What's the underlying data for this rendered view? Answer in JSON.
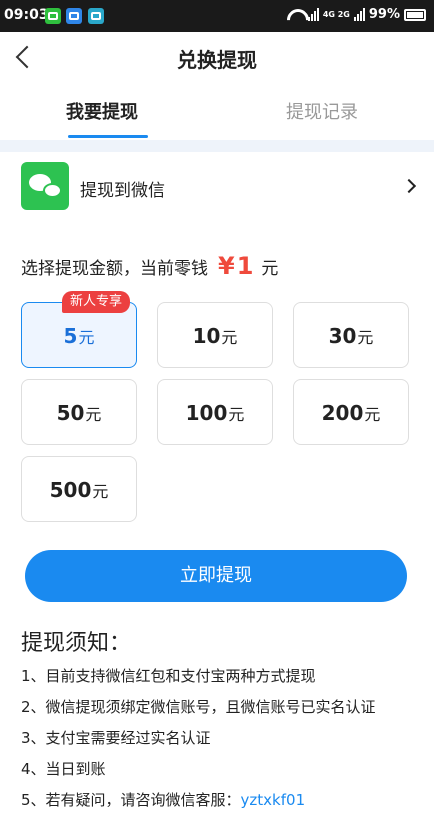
{
  "status_bar": {
    "time": "09:03",
    "battery": "99%",
    "network": "4G 2G",
    "app_icons": [
      "wechat-icon",
      "message-icon",
      "scan-icon"
    ]
  },
  "nav": {
    "title": "兑换提现"
  },
  "tabs": [
    {
      "label": "我要提现",
      "active": true
    },
    {
      "label": "提现记录",
      "active": false
    }
  ],
  "wechat_option": {
    "label": "提现到微信"
  },
  "amount_heading": {
    "prefix": "选择提现金额，当前零钱",
    "currency_symbol": "¥",
    "balance": "1",
    "unit": "元"
  },
  "amounts": [
    {
      "value": "5",
      "unit": "元",
      "selected": true,
      "badge": "新人专享"
    },
    {
      "value": "10",
      "unit": "元"
    },
    {
      "value": "30",
      "unit": "元"
    },
    {
      "value": "50",
      "unit": "元"
    },
    {
      "value": "100",
      "unit": "元"
    },
    {
      "value": "200",
      "unit": "元"
    },
    {
      "value": "500",
      "unit": "元"
    }
  ],
  "submit_label": "立即提现",
  "notice": {
    "title": "提现须知：",
    "items": [
      "1、目前支持微信红包和支付宝两种方式提现",
      "2、微信提现须绑定微信账号，且微信账号已实名认证",
      "3、支付宝需要经过实名认证",
      "4、当日到账"
    ],
    "last_item_prefix": "5、若有疑问，请咨询微信客服：",
    "service_id": "yztxkf01"
  },
  "colors": {
    "accent": "#1a8af0",
    "price_red": "#ef4a3c",
    "badge_red": "#ec4040",
    "wechat_green": "#2dc251"
  }
}
